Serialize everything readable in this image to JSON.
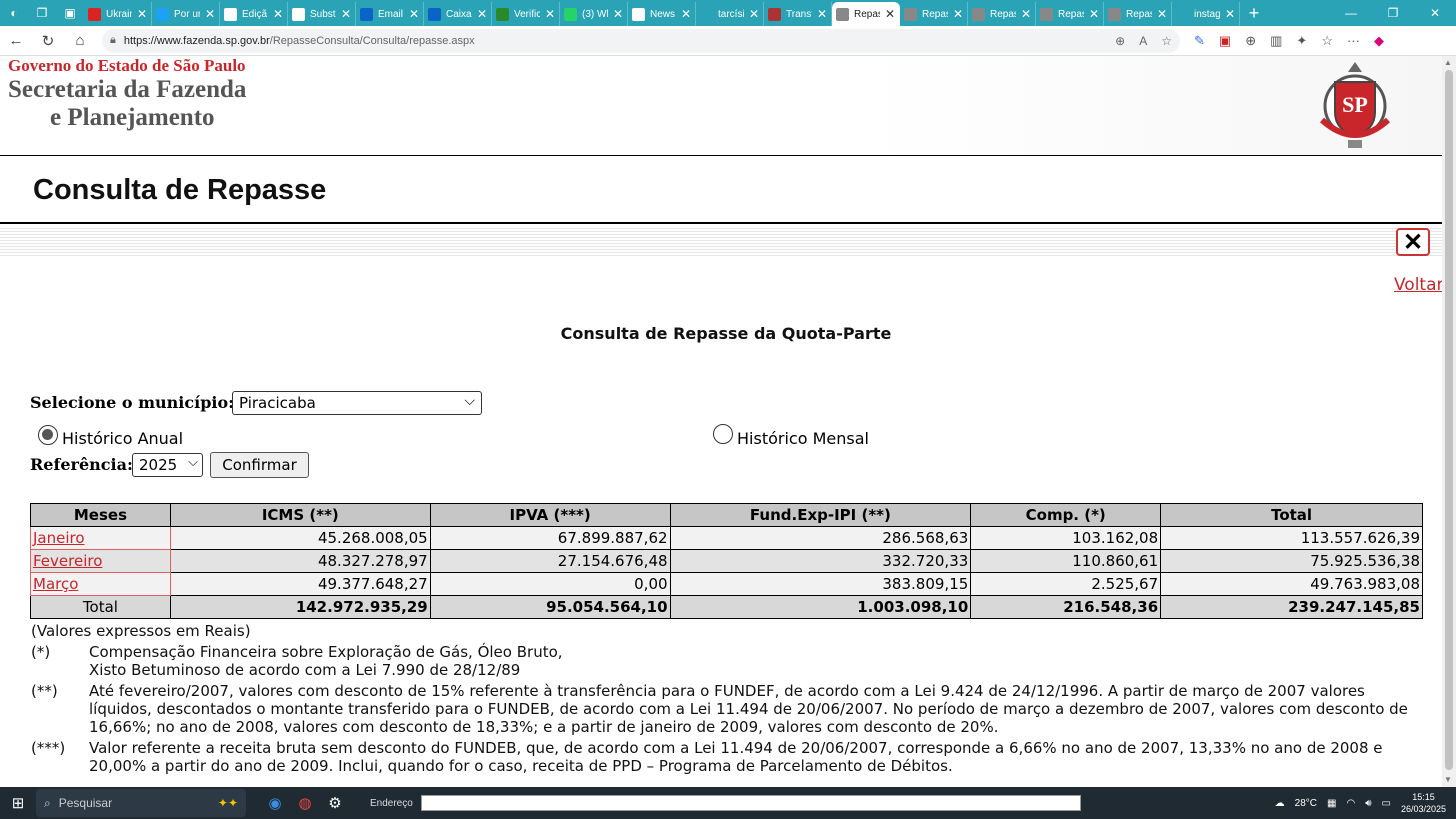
{
  "browser": {
    "tabs": [
      {
        "label": "Ukrain",
        "color": "#d22"
      },
      {
        "label": "Por ur",
        "color": "#1da1f2"
      },
      {
        "label": "Ediçã",
        "color": "#ffffff"
      },
      {
        "label": "Subst",
        "color": "#ffffff"
      },
      {
        "label": "Email",
        "color": "#0a64c8"
      },
      {
        "label": "Caixa",
        "color": "#0a64c8"
      },
      {
        "label": "Verific",
        "color": "#2a8a2a"
      },
      {
        "label": "(3) Wl",
        "color": "#25d366"
      },
      {
        "label": "News",
        "color": "#ffffff"
      },
      {
        "label": "tarcísi",
        "color": "#29a3b5"
      },
      {
        "label": "Transf",
        "color": "#a33"
      },
      {
        "label": "Repas",
        "color": "#888"
      },
      {
        "label": "Repas",
        "color": "#888"
      },
      {
        "label": "Repas",
        "color": "#888"
      },
      {
        "label": "Repas",
        "color": "#888"
      },
      {
        "label": "Repas",
        "color": "#888"
      },
      {
        "label": "instag",
        "color": "#29a3b5"
      }
    ],
    "active_tab_index": 11,
    "url_host": "https://www.fazenda.sp.gov.br",
    "url_path": "/RepasseConsulta/Consulta/repasse.aspx"
  },
  "header": {
    "gov": "Governo do Estado de São Paulo",
    "sec_line1": "Secretaria da Fazenda",
    "sec_line2": "e Planejamento",
    "crest_text": "SP"
  },
  "page_title": "Consulta de Repasse",
  "voltar": "Voltar",
  "subtitle": "Consulta de Repasse da Quota-Parte",
  "form": {
    "municipio_label": "Selecione o município:",
    "municipio_value": "Piracicaba",
    "radio_anual": "Histórico Anual",
    "radio_mensal": "Histórico Mensal",
    "referencia_label": "Referência:",
    "referencia_value": "2025",
    "confirmar": "Confirmar"
  },
  "table": {
    "headers": [
      "Meses",
      "ICMS (**)",
      "IPVA (***)",
      "Fund.Exp-IPI (**)",
      "Comp. (*)",
      "Total"
    ],
    "rows": [
      {
        "mes": "Janeiro",
        "icms": "45.268.008,05",
        "ipva": "67.899.887,62",
        "ipi": "286.568,63",
        "comp": "103.162,08",
        "total": "113.557.626,39"
      },
      {
        "mes": "Fevereiro",
        "icms": "48.327.278,97",
        "ipva": "27.154.676,48",
        "ipi": "332.720,33",
        "comp": "110.860,61",
        "total": "75.925.536,38"
      },
      {
        "mes": "Março",
        "icms": "49.377.648,27",
        "ipva": "0,00",
        "ipi": "383.809,15",
        "comp": "2.525,67",
        "total": "49.763.983,08"
      }
    ],
    "total": {
      "label": "Total",
      "icms": "142.972.935,29",
      "ipva": "95.054.564,10",
      "ipi": "1.003.098,10",
      "comp": "216.548,36",
      "total": "239.247.145,85"
    }
  },
  "notes": {
    "valores": "(Valores expressos em Reais)",
    "items": [
      {
        "mark": "(*)",
        "text": "Compensação Financeira sobre Exploração de Gás, Óleo Bruto, Xisto Betuminoso de acordo com a Lei 7.990 de 28/12/89"
      },
      {
        "mark": "(**)",
        "text": "Até fevereiro/2007, valores com desconto de 15% referente à transferência para o FUNDEF, de acordo com a Lei 9.424 de 24/12/1996. A partir de março de 2007 valores líquidos, descontados o montante transferido para o FUNDEB, de acordo com a Lei 11.494 de 20/06/2007. No período de março a dezembro de 2007, valores com desconto de 16,66%; no ano de 2008, valores com desconto de 18,33%; e a partir de janeiro de 2009, valores com desconto de 20%."
      },
      {
        "mark": "(***)",
        "text": "Valor referente a receita bruta sem desconto do FUNDEB, que, de acordo com a Lei 11.494 de 20/06/2007, corresponde a 6,66% no ano de 2007, 13,33% no ano de 2008 e 20,00% a partir do ano de 2009. Inclui, quando for o caso, receita de PPD – Programa de Parcelamento de Débitos."
      }
    ]
  },
  "taskbar": {
    "search_placeholder": "Pesquisar",
    "endereco_label": "Endereço",
    "weather": "28°C",
    "time": "15:15",
    "date": "26/03/2025"
  }
}
